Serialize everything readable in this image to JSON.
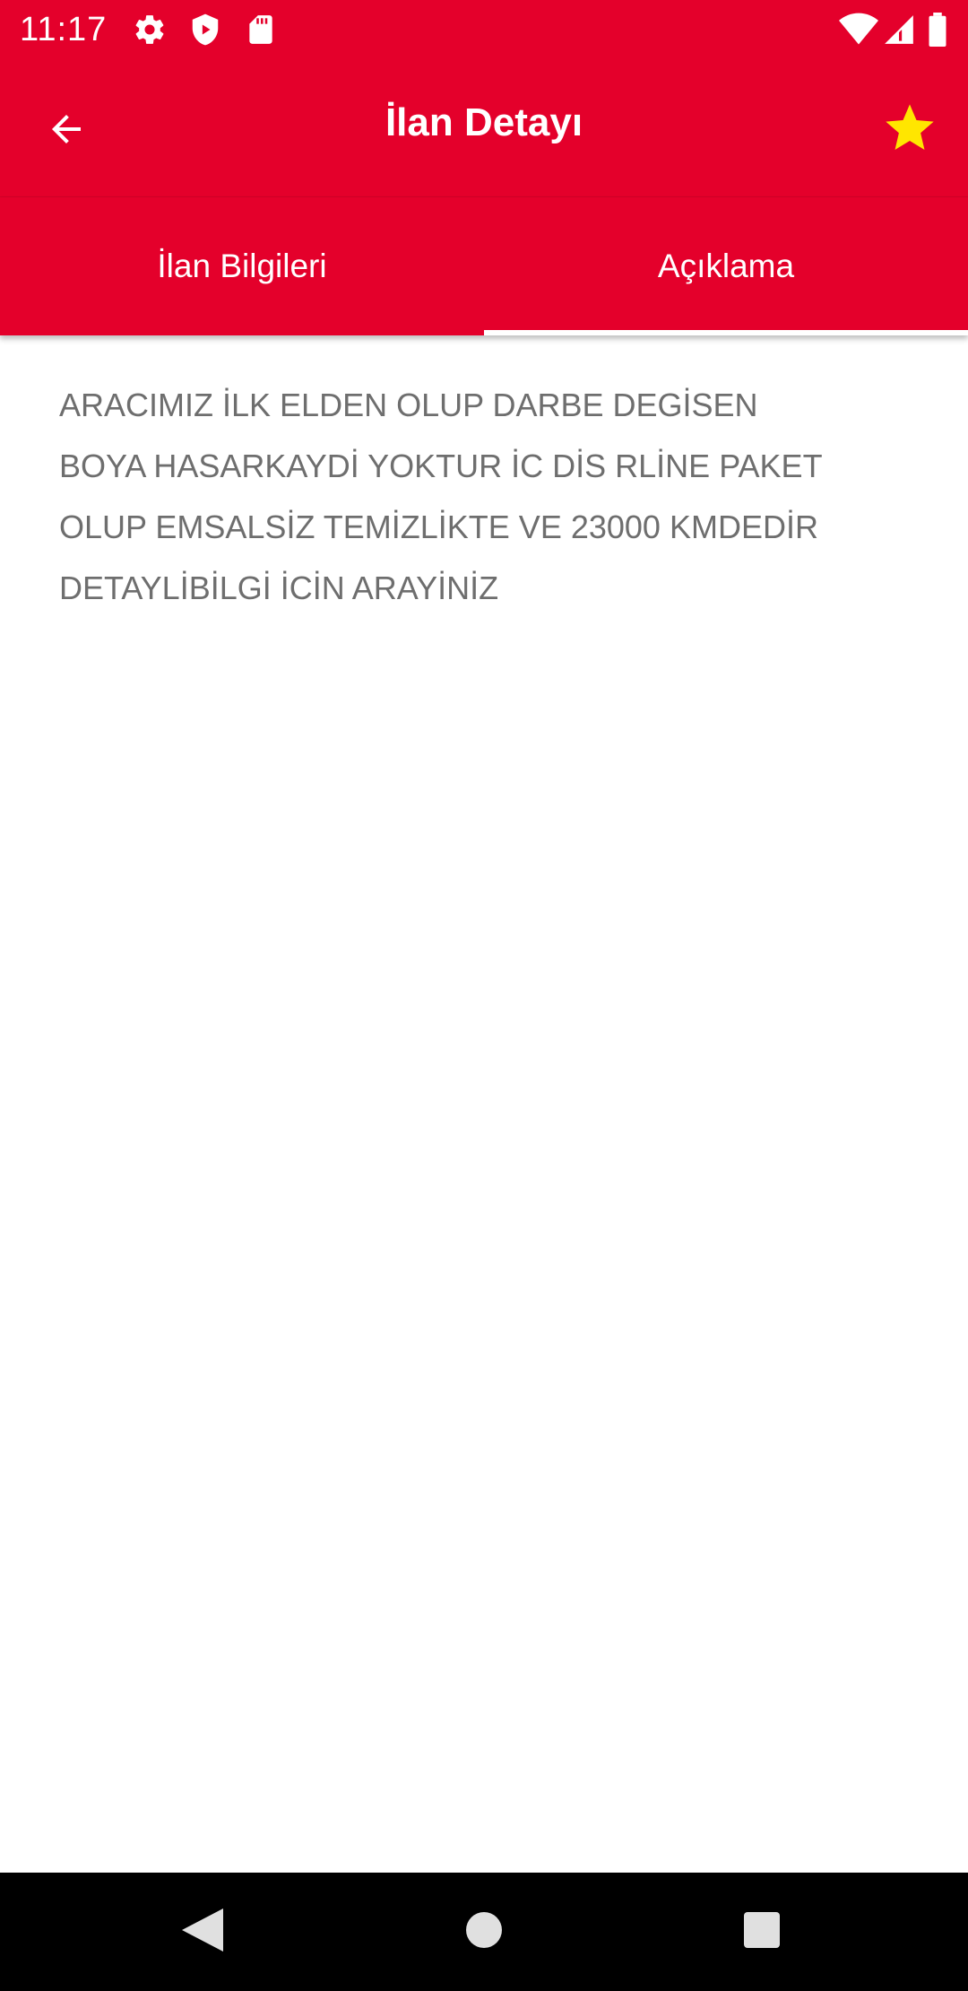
{
  "status_bar": {
    "time": "11:17",
    "icons_left": [
      "gear-icon",
      "shield-icon",
      "sd-card-icon"
    ],
    "icons_right": [
      "wifi-icon",
      "cellular-signal-icon",
      "battery-icon"
    ]
  },
  "app_bar": {
    "title": "İlan Detayı",
    "back_icon": "arrow-left-icon",
    "favorite_icon": "star-icon",
    "favorite_color": "#ffe600"
  },
  "tabs": [
    {
      "label": "İlan Bilgileri",
      "selected": false
    },
    {
      "label": "Açıklama",
      "selected": true
    }
  ],
  "description": {
    "text": "ARACIMIZ İLK ELDEN OLUP DARBE DEGİSEN\nBOYA HASARKAYDİ YOKTUR İC DİS RLİNE PAKET\nOLUP EMSALSİZ TEMİZLİKTE VE 23000 KMDEDİR\nDETAYLİBİLGİ İCİN ARAYİNİZ"
  },
  "navigation_bar": {
    "buttons": [
      "back-triangle-icon",
      "home-circle-icon",
      "recents-square-icon"
    ]
  },
  "colors": {
    "primary": "#e4002b",
    "on_primary": "#ffffff",
    "body_text": "#6e6e6e",
    "nav_bar": "#000000"
  }
}
